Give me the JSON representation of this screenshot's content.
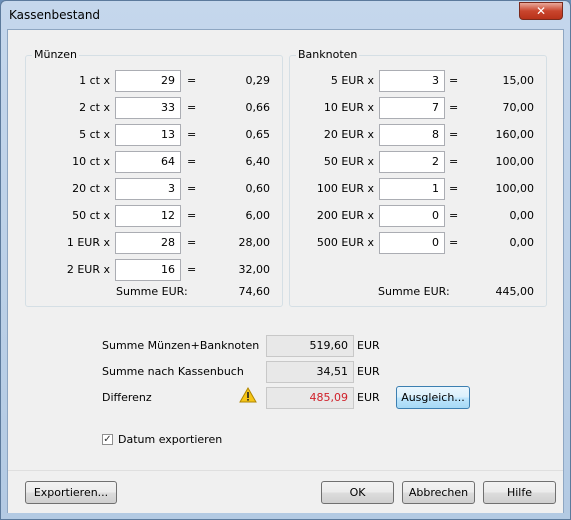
{
  "window": {
    "title": "Kassenbestand",
    "close_glyph": "✕"
  },
  "muenzen": {
    "title": "Münzen",
    "rows": [
      {
        "label": "1 ct x",
        "count": "29",
        "eq": "=",
        "sum": "0,29"
      },
      {
        "label": "2 ct x",
        "count": "33",
        "eq": "=",
        "sum": "0,66"
      },
      {
        "label": "5 ct x",
        "count": "13",
        "eq": "=",
        "sum": "0,65"
      },
      {
        "label": "10 ct x",
        "count": "64",
        "eq": "=",
        "sum": "6,40"
      },
      {
        "label": "20 ct x",
        "count": "3",
        "eq": "=",
        "sum": "0,60"
      },
      {
        "label": "50 ct x",
        "count": "12",
        "eq": "=",
        "sum": "6,00"
      },
      {
        "label": "1 EUR x",
        "count": "28",
        "eq": "=",
        "sum": "28,00"
      },
      {
        "label": "2 EUR x",
        "count": "16",
        "eq": "=",
        "sum": "32,00"
      }
    ],
    "total_label": "Summe EUR:",
    "total_value": "74,60"
  },
  "banknoten": {
    "title": "Banknoten",
    "rows": [
      {
        "label": "5 EUR x",
        "count": "3",
        "eq": "=",
        "sum": "15,00"
      },
      {
        "label": "10 EUR x",
        "count": "7",
        "eq": "=",
        "sum": "70,00"
      },
      {
        "label": "20 EUR x",
        "count": "8",
        "eq": "=",
        "sum": "160,00"
      },
      {
        "label": "50 EUR x",
        "count": "2",
        "eq": "=",
        "sum": "100,00"
      },
      {
        "label": "100 EUR x",
        "count": "1",
        "eq": "=",
        "sum": "100,00"
      },
      {
        "label": "200 EUR x",
        "count": "0",
        "eq": "=",
        "sum": "0,00"
      },
      {
        "label": "500 EUR x",
        "count": "0",
        "eq": "=",
        "sum": "0,00"
      }
    ],
    "total_label": "Summe EUR:",
    "total_value": "445,00"
  },
  "summary": {
    "rows": [
      {
        "label": "Summe Münzen+Banknoten",
        "value": "519,60",
        "unit": "EUR"
      },
      {
        "label": "Summe nach Kassenbuch",
        "value": "34,51",
        "unit": "EUR"
      },
      {
        "label": "Differenz",
        "value": "485,09",
        "unit": "EUR"
      }
    ],
    "warning_icon": "warning-triangle-icon",
    "difference_color": "#d0202a",
    "balance_button": "Ausgleich..."
  },
  "export_date": {
    "label": "Datum exportieren",
    "checked": true,
    "check_glyph": "✓"
  },
  "buttons": {
    "export": "Exportieren...",
    "ok": "OK",
    "cancel": "Abbrechen",
    "help": "Hilfe"
  }
}
